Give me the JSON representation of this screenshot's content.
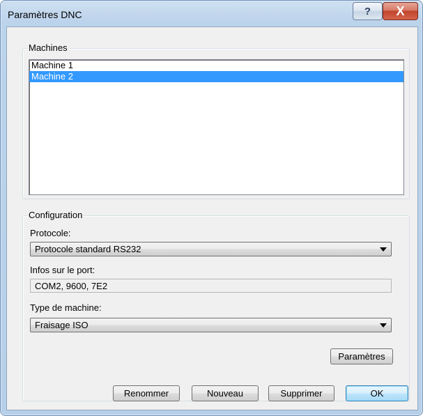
{
  "window": {
    "title": "Paramètres DNC",
    "help_icon": "?",
    "close_icon": "X"
  },
  "machines": {
    "group_label": "Machines",
    "items": [
      {
        "label": "Machine 1",
        "selected": false
      },
      {
        "label": "Machine 2",
        "selected": true
      }
    ]
  },
  "configuration": {
    "group_label": "Configuration",
    "protocol_label": "Protocole:",
    "protocol_value": "Protocole standard RS232",
    "port_info_label": "Infos sur le port:",
    "port_info_value": "COM2, 9600, 7E2",
    "machine_type_label": "Type de machine:",
    "machine_type_value": "Fraisage ISO",
    "params_button": "Paramètres"
  },
  "footer": {
    "rename_button": "Renommer",
    "new_button": "Nouveau",
    "delete_button": "Supprimer",
    "ok_button": "OK"
  },
  "colors": {
    "selection": "#3399ff",
    "dialog_background": "#f0f0f0",
    "title_frame": "#bcd3ec"
  }
}
